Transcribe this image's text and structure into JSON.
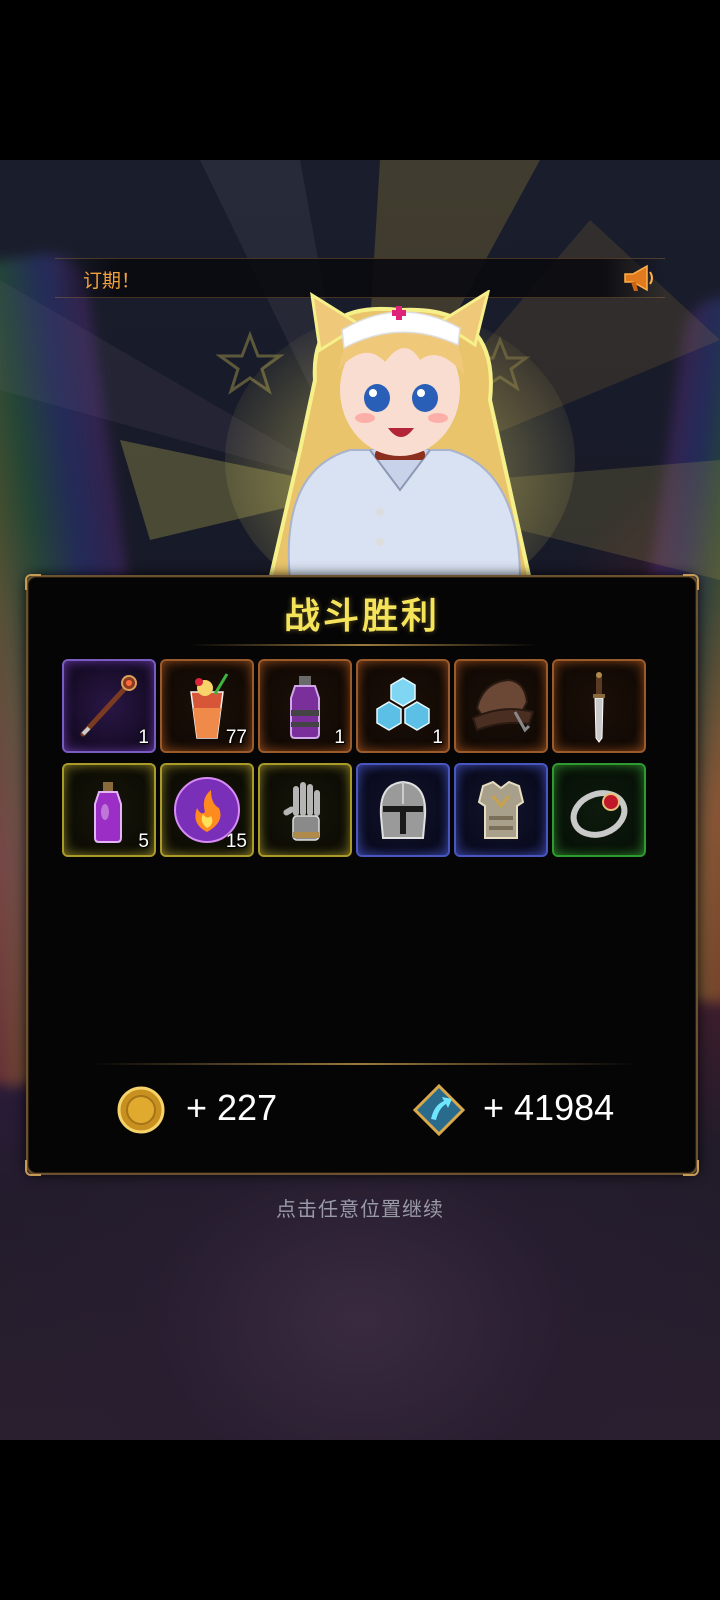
{
  "notice": {
    "text": "订期！"
  },
  "result": {
    "title": "战斗胜利"
  },
  "items": [
    {
      "name": "staff",
      "icon": "staff-icon",
      "quantity": "1",
      "quality": "purple"
    },
    {
      "name": "cocktail",
      "icon": "cocktail-icon",
      "quantity": "77",
      "quality": "orange"
    },
    {
      "name": "potion-bottle",
      "icon": "potion-bottle-icon",
      "quantity": "1",
      "quality": "orange"
    },
    {
      "name": "crystal-cluster",
      "icon": "crystal-icon",
      "quantity": "1",
      "quality": "orange"
    },
    {
      "name": "hat",
      "icon": "hat-icon",
      "quantity": "",
      "quality": "orange"
    },
    {
      "name": "dagger",
      "icon": "dagger-icon",
      "quantity": "",
      "quality": "orange"
    },
    {
      "name": "small-potion",
      "icon": "small-potion-icon",
      "quantity": "5",
      "quality": "yellow"
    },
    {
      "name": "fire-orb",
      "icon": "fire-orb-icon",
      "quantity": "15",
      "quality": "yellow"
    },
    {
      "name": "gauntlet",
      "icon": "gauntlet-icon",
      "quantity": "",
      "quality": "yellow"
    },
    {
      "name": "helmet",
      "icon": "helmet-icon",
      "quantity": "",
      "quality": "blue"
    },
    {
      "name": "chest-armor",
      "icon": "chest-armor-icon",
      "quantity": "",
      "quality": "blue"
    },
    {
      "name": "ring",
      "icon": "ring-icon",
      "quantity": "",
      "quality": "green"
    }
  ],
  "rewards": {
    "gold": {
      "icon": "gold-coin-icon",
      "text": "+ 227"
    },
    "exp": {
      "icon": "exp-arrow-icon",
      "text": "+ 41984"
    }
  },
  "footer": {
    "continue_text": "点击任意位置继续"
  },
  "colors": {
    "title": "#f5e35a",
    "notice": "#f3a23a",
    "purple": "#7a5bc0",
    "orange": "#9b5a2a",
    "yellow": "#a99a2a",
    "blue": "#4a56c0",
    "green": "#2f9a2f"
  }
}
